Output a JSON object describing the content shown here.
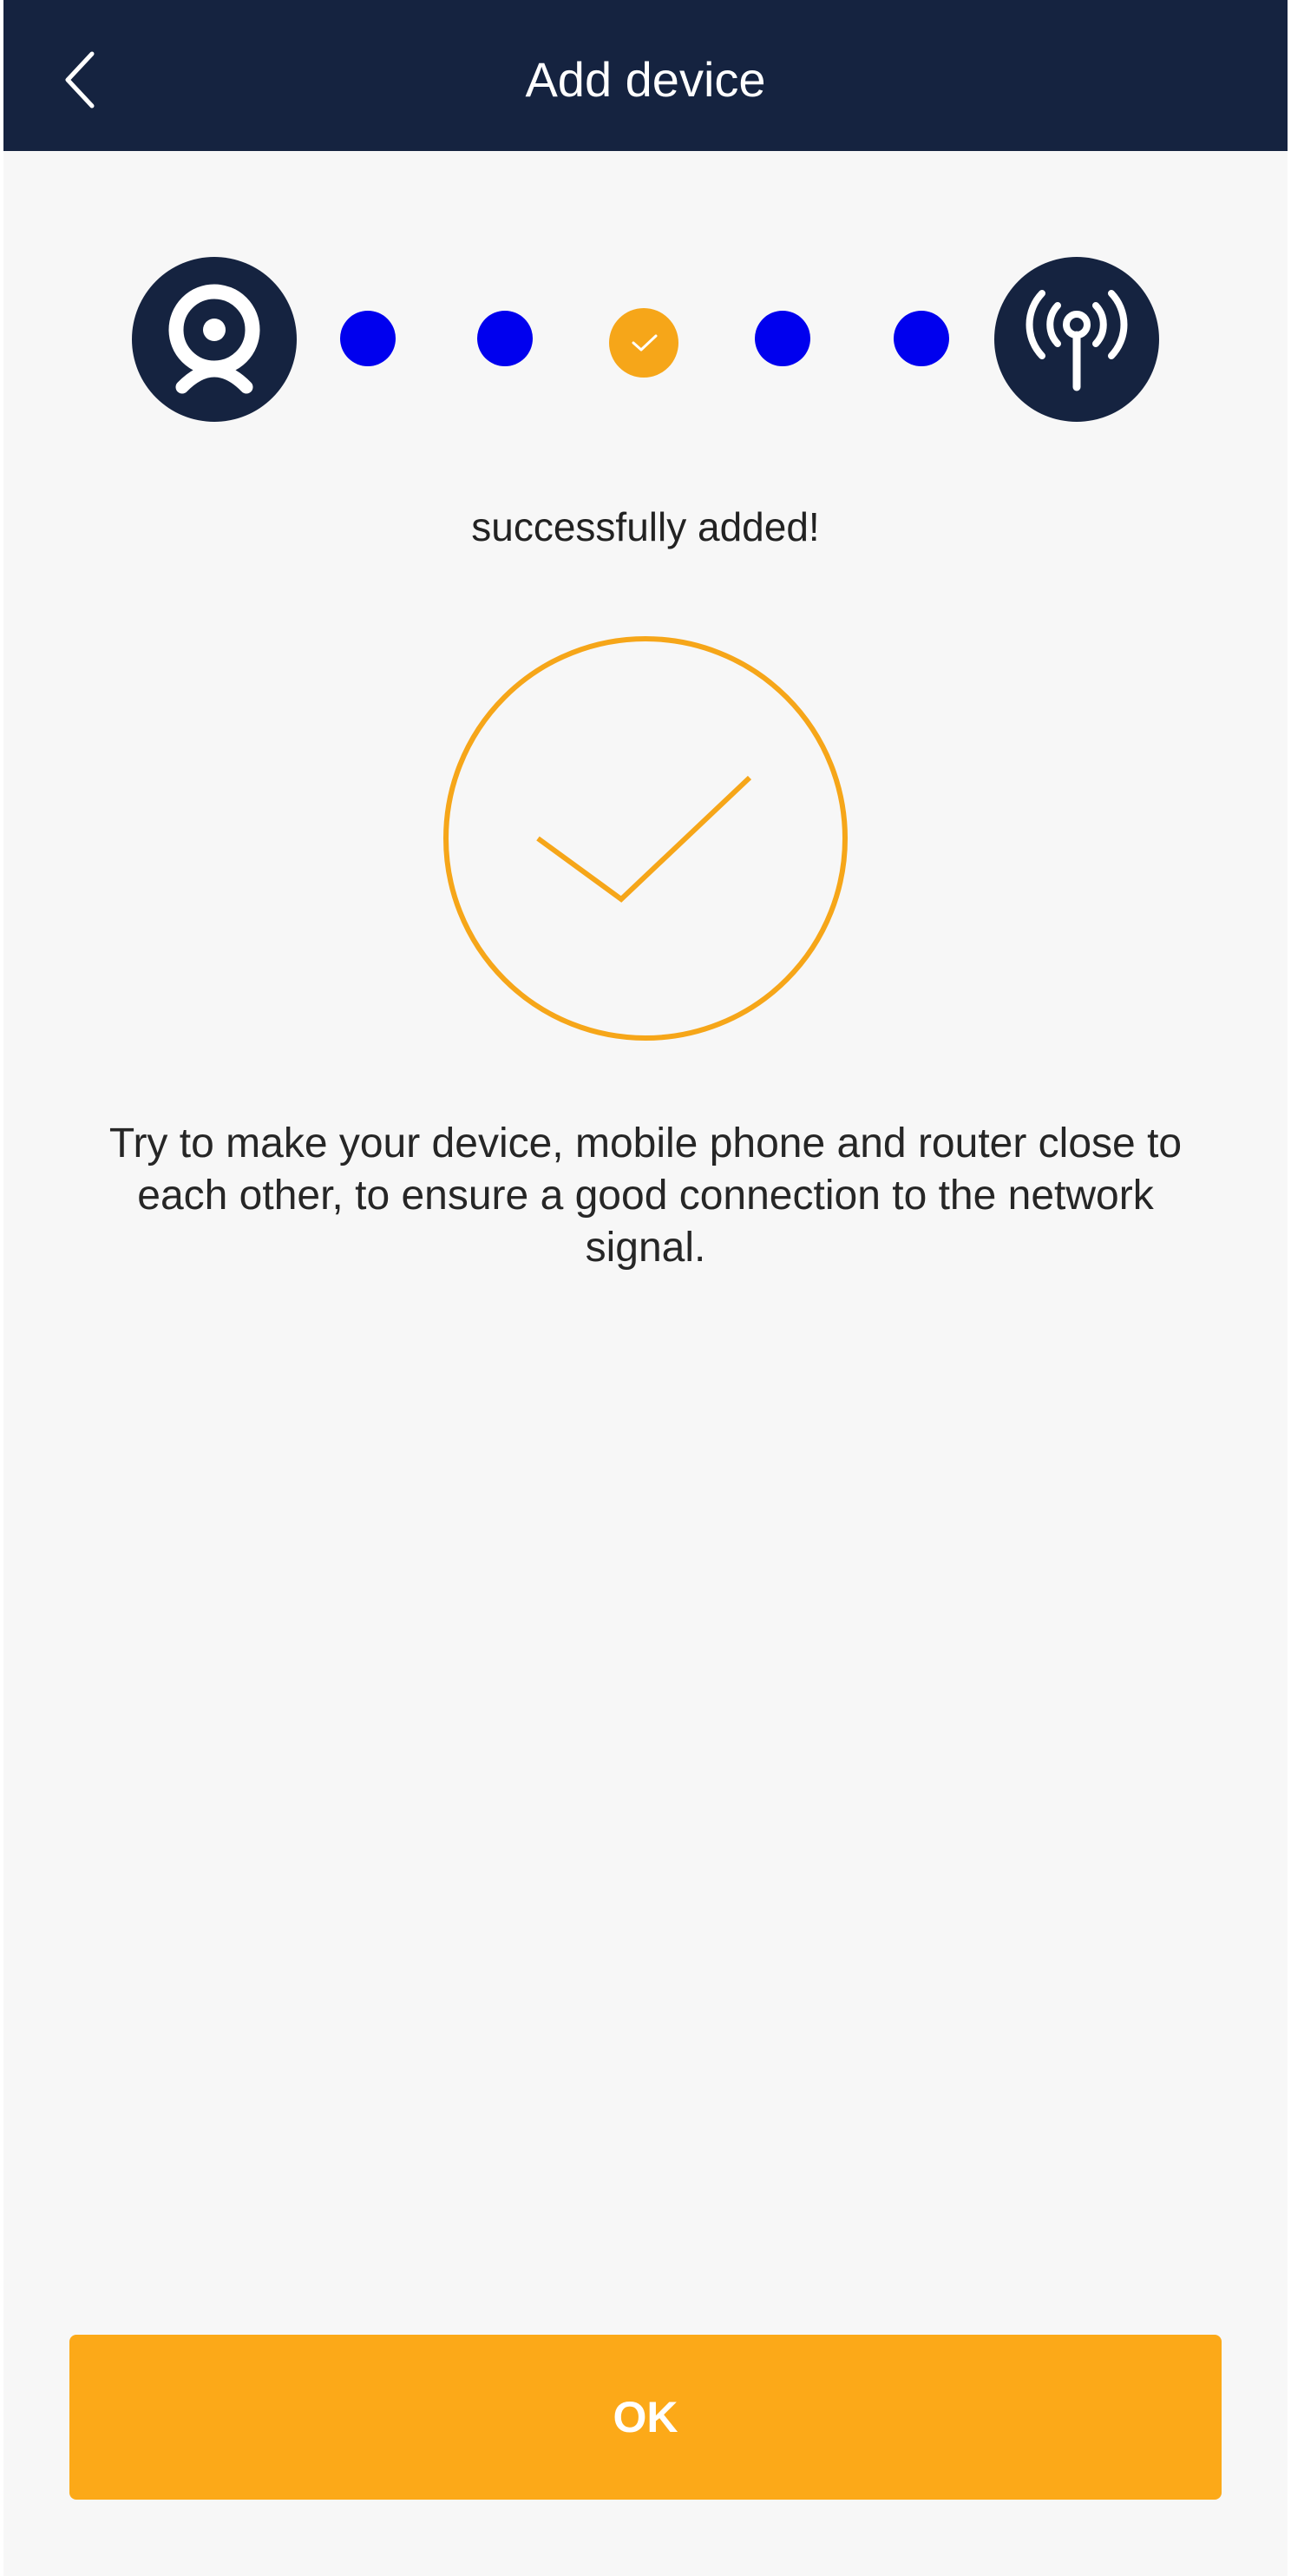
{
  "header": {
    "title": "Add device",
    "back_icon": "chevron-left-icon"
  },
  "progress": {
    "start_icon": "webcam-icon",
    "end_icon": "antenna-signal-icon",
    "total_dots": 5,
    "current_dot": 3,
    "current_icon": "check-icon",
    "colors": {
      "dot": "#0000ee",
      "current": "#f6a619",
      "icon_bg": "#152340"
    }
  },
  "status": {
    "message": "successfully added!",
    "icon": "success-check-icon"
  },
  "hint": {
    "text": "Try to make your device, mobile phone and router close to each other, to ensure a good connection to the network signal."
  },
  "actions": {
    "ok_label": "OK"
  },
  "colors": {
    "header_bg": "#152340",
    "accent": "#fca918"
  }
}
